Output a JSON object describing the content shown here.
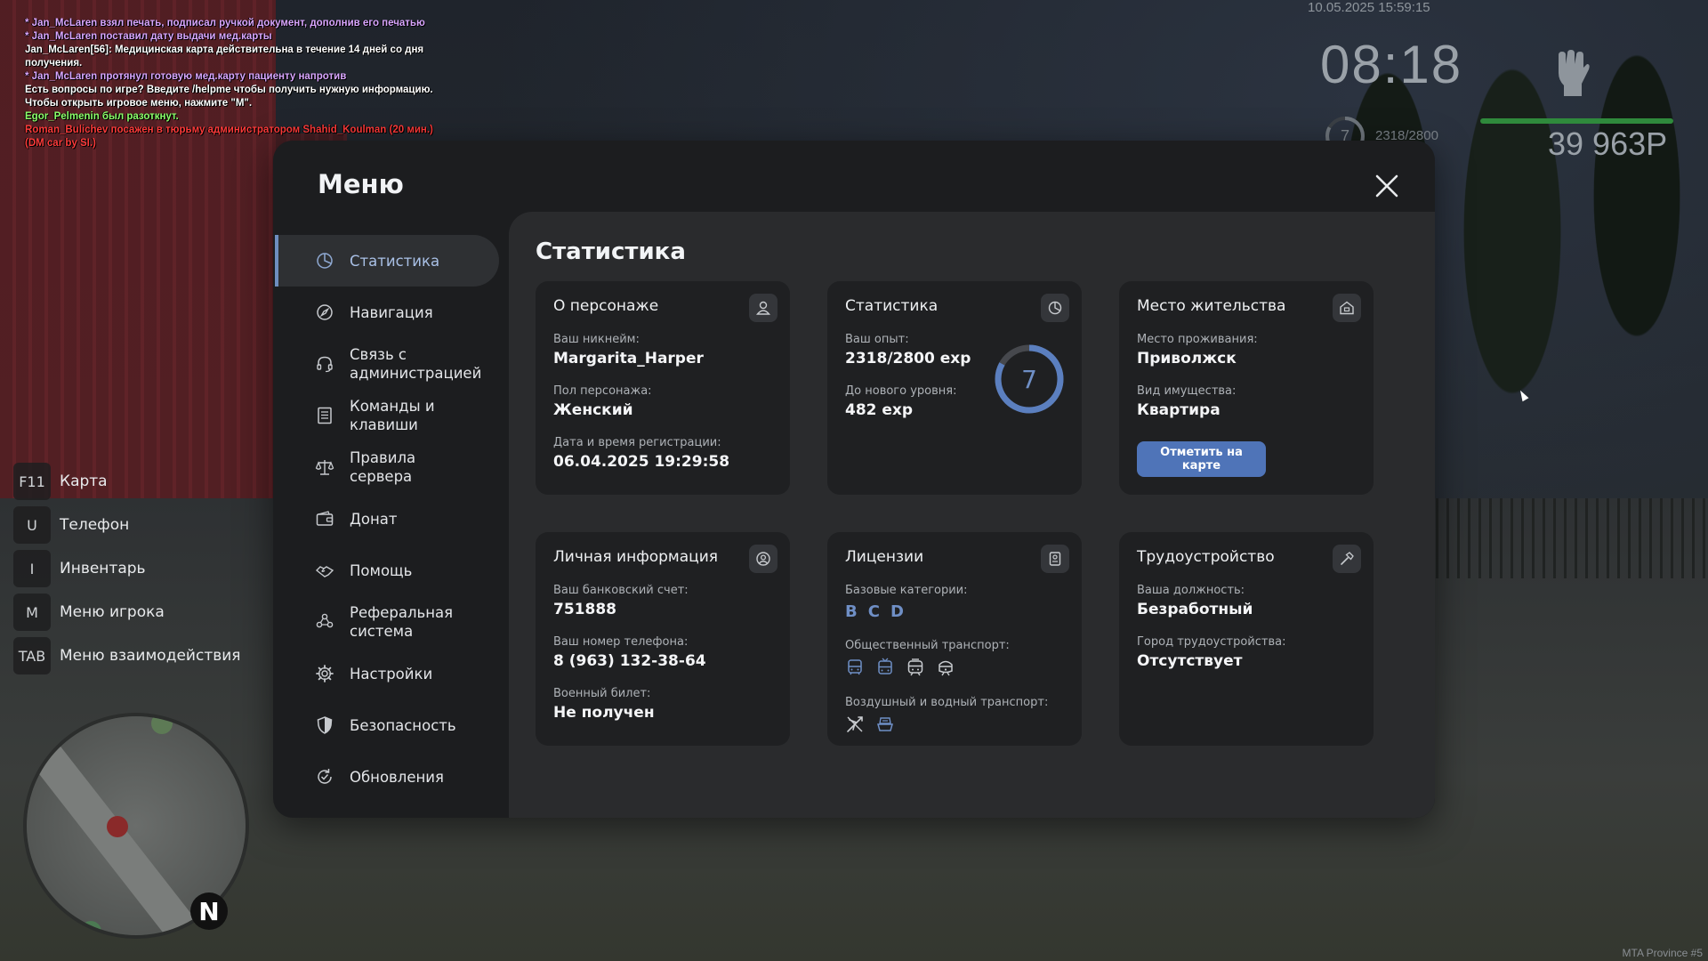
{
  "chat": [
    {
      "text": "* Jan_McLaren взял печать, подписал ручкой документ, дополнив его печатью",
      "color": "#d9a6ff"
    },
    {
      "text": "* Jan_McLaren поставил дату выдачи мед.карты",
      "color": "#d9a6ff"
    },
    {
      "text": "Jan_McLaren[56]: Медицинская карта действительна в течение 14 дней со дня получения.",
      "color": "#ffffff"
    },
    {
      "text": "* Jan_McLaren протянул готовую мед.карту пациенту напротив",
      "color": "#d9a6ff"
    },
    {
      "text": "Есть вопросы по игре? Введите /helpme чтобы получить нужную информацию.",
      "color": "#ffffff"
    },
    {
      "text": "Чтобы открыть игровое меню, нажмите \"M\".",
      "color": "#ffffff"
    },
    {
      "text": "Egor_Pelmenin был разоткнут.",
      "color": "#8cff6a"
    },
    {
      "text": "Roman_Bulichev посажен в тюрьму администратором Shahid_Koulman (20 мин.) (DM car by SI.)",
      "color": "#ff3b3b"
    }
  ],
  "hud": {
    "datetime": "10.05.2025 15:59:15",
    "clock": "08:18",
    "level": "7",
    "exp": "2318/2800",
    "money": "39 963Р",
    "health_fraction": 0.95
  },
  "keys": [
    {
      "key": "F11",
      "label": "Карта"
    },
    {
      "key": "U",
      "label": "Телефон"
    },
    {
      "key": "I",
      "label": "Инвентарь"
    },
    {
      "key": "M",
      "label": "Меню игрока"
    },
    {
      "key": "TAB",
      "label": "Меню взаимодействия"
    }
  ],
  "compass": "N",
  "watermark": "MTA Province #5",
  "menu": {
    "title": "Меню",
    "nav": [
      {
        "label": "Статистика",
        "icon": "chart-pie-icon",
        "active": true
      },
      {
        "label": "Навигация",
        "icon": "compass-icon"
      },
      {
        "label": "Связь с администрацией",
        "icon": "headset-icon"
      },
      {
        "label": "Команды и клавиши",
        "icon": "list-icon"
      },
      {
        "label": "Правила сервера",
        "icon": "scales-icon"
      },
      {
        "label": "Донат",
        "icon": "wallet-icon"
      },
      {
        "label": "Помощь",
        "icon": "handshake-icon"
      },
      {
        "label": "Реферальная система",
        "icon": "users-icon"
      },
      {
        "label": "Настройки",
        "icon": "gear-icon"
      },
      {
        "label": "Безопасность",
        "icon": "shield-icon"
      },
      {
        "label": "Обновления",
        "icon": "refresh-icon"
      }
    ],
    "section_title": "Статистика",
    "cards": {
      "character": {
        "title": "О персонаже",
        "icon": "user-icon",
        "nickname_label": "Ваш никнейм:",
        "nickname": "Margarita_Harper",
        "gender_label": "Пол персонажа:",
        "gender": "Женский",
        "reg_label": "Дата и время регистрации:",
        "reg": "06.04.2025 19:29:58"
      },
      "stats": {
        "title": "Статистика",
        "icon": "chart-pie-icon",
        "exp_label": "Ваш опыт:",
        "exp": "2318/2800 exp",
        "next_label": "До нового уровня:",
        "next": "482 exp",
        "level": "7",
        "progress": 0.83
      },
      "residence": {
        "title": "Место жительства",
        "icon": "house-icon",
        "place_label": "Место проживания:",
        "place": "Приволжск",
        "type_label": "Вид имущества:",
        "type": "Квартира",
        "button": "Отметить на карте"
      },
      "personal": {
        "title": "Личная информация",
        "icon": "user-circle-icon",
        "bank_label": "Ваш банковский счет:",
        "bank": "751888",
        "phone_label": "Ваш номер телефона:",
        "phone": "8 (963) 132-38-64",
        "military_label": "Военный билет:",
        "military": "Не получен"
      },
      "licenses": {
        "title": "Лицензии",
        "icon": "id-card-icon",
        "base_label": "Базовые категории:",
        "base": [
          "B",
          "C",
          "D"
        ],
        "public_label": "Общественный транспорт:",
        "public_icons": [
          "bus-icon",
          "trolleybus-icon",
          "tram-icon",
          "train-icon"
        ],
        "public_on": [
          true,
          true,
          false,
          false
        ],
        "air_label": "Воздушный и водный транспорт:",
        "air_icons": [
          "plane-icon",
          "boat-icon"
        ],
        "air_on": [
          false,
          true
        ]
      },
      "job": {
        "title": "Трудоустройство",
        "icon": "hammer-icon",
        "position_label": "Ваша должность:",
        "position": "Безработный",
        "city_label": "Город трудоустройства:",
        "city": "Отсутствует"
      }
    }
  }
}
